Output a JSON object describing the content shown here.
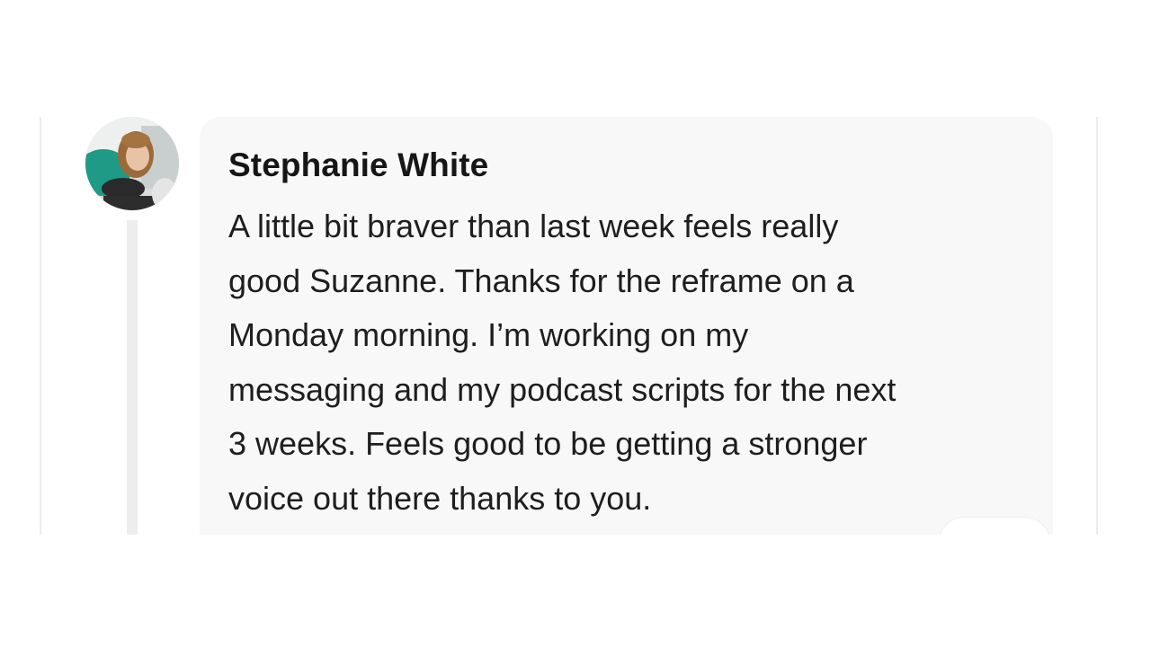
{
  "comment": {
    "author": "Stephanie White",
    "lines": [
      "A little bit braver than last week feels really",
      "good Suzanne. Thanks for the reframe on a",
      "Monday morning. I’m working on my",
      "messaging and my podcast scripts for the next",
      "3 weeks. Feels good to be getting a stronger",
      "voice out there thanks to you."
    ]
  },
  "avatar": {
    "icon": "user-photo"
  },
  "colors": {
    "bubble": "#f8f8f8",
    "thread_line": "#ededed",
    "text": "#1e1e1e"
  }
}
